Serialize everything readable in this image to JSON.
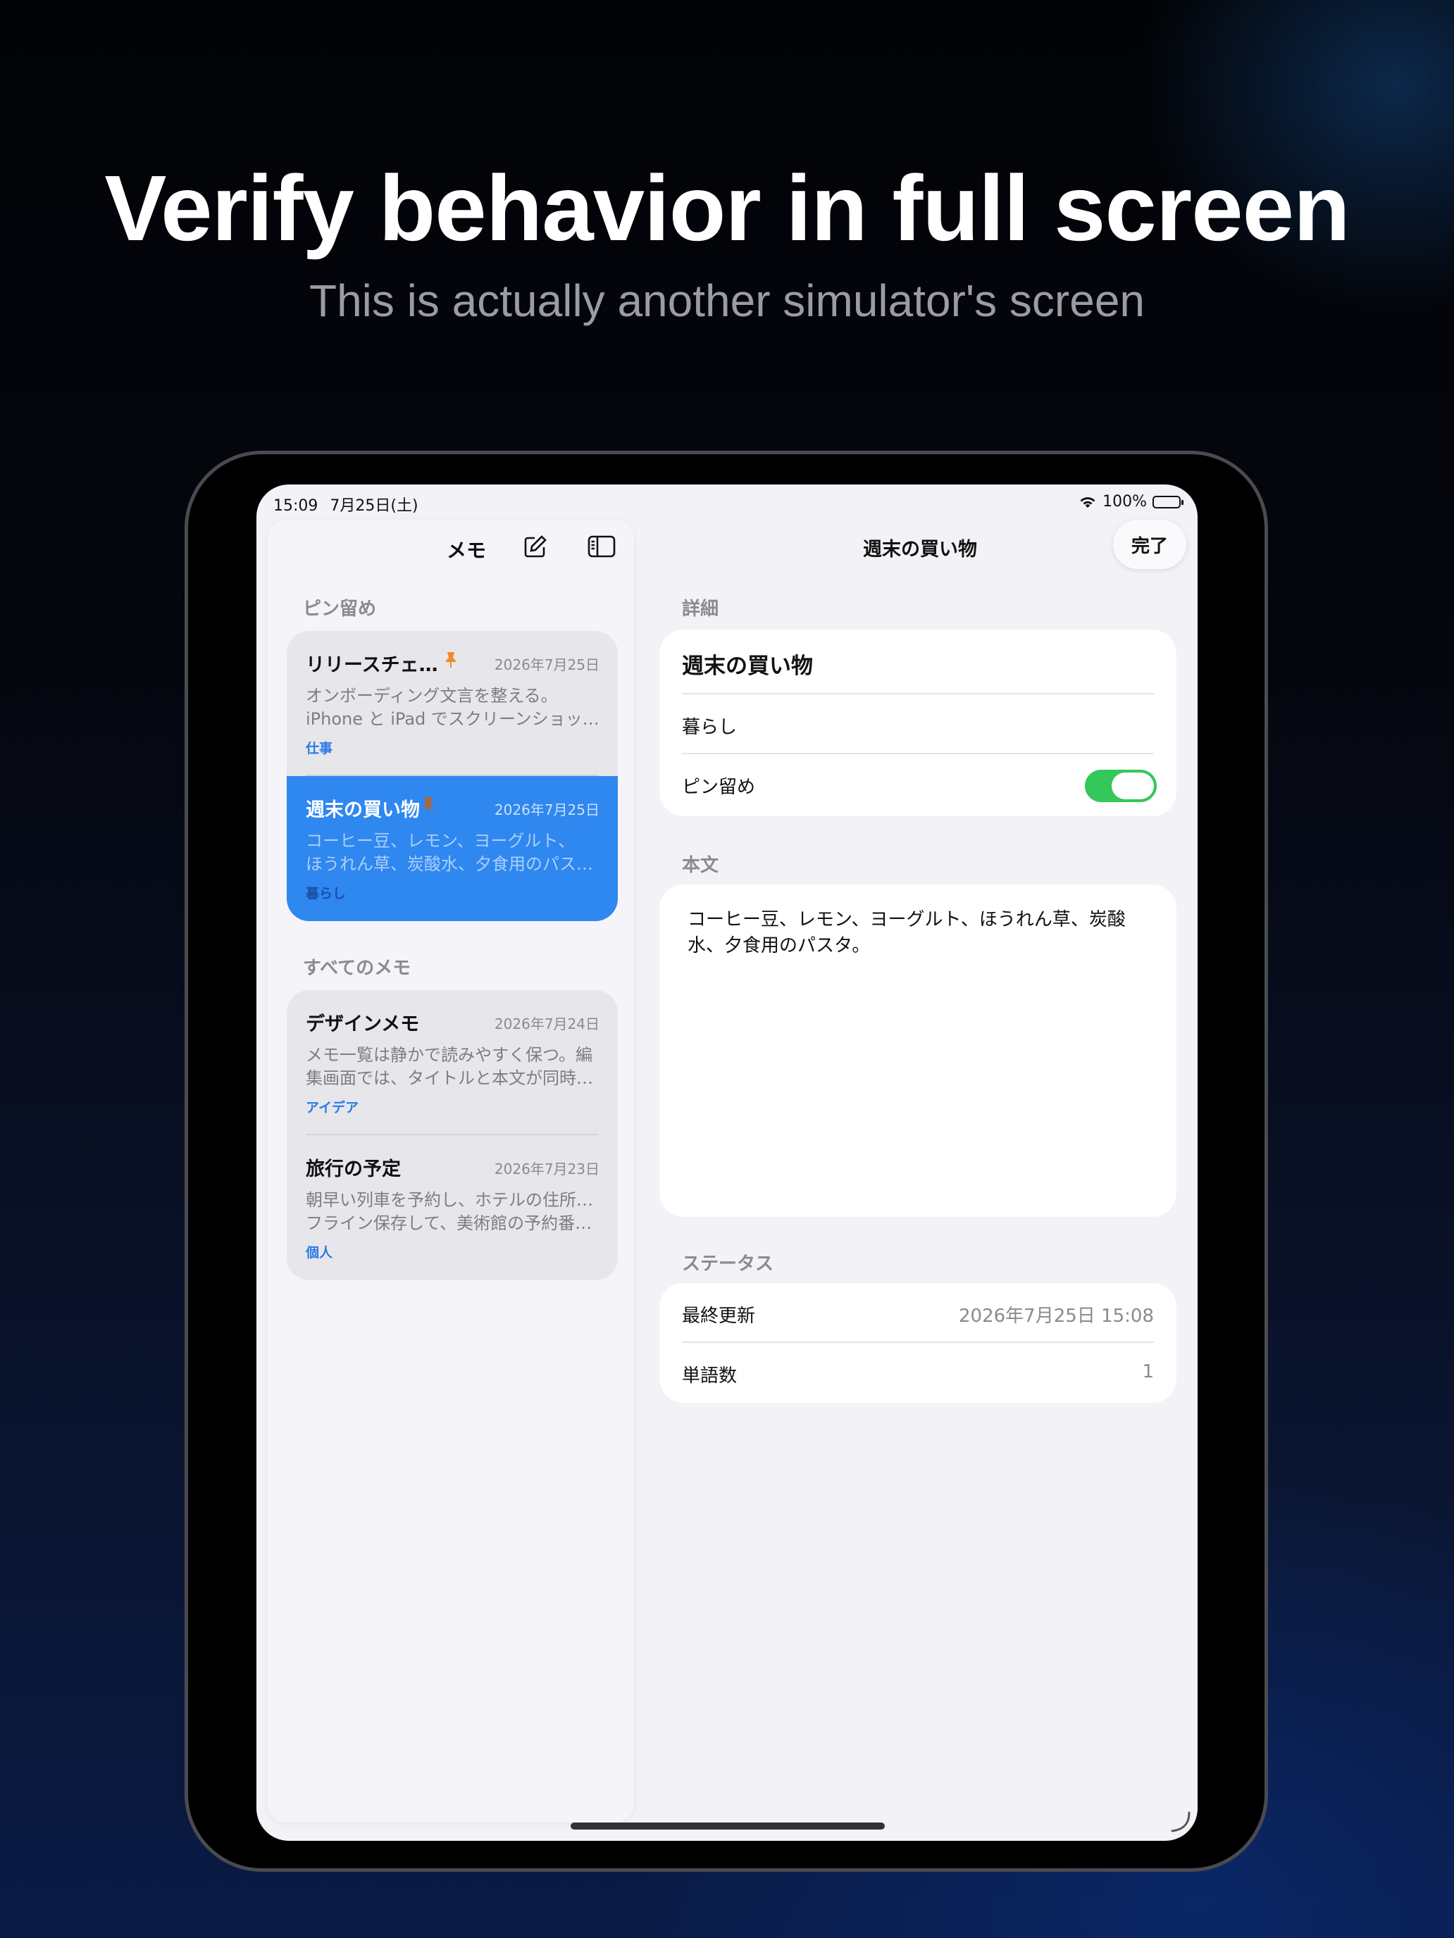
{
  "promo": {
    "headline": "Verify behavior in full screen",
    "subhead": "This is actually another simulator's screen"
  },
  "status_bar": {
    "time": "15:09",
    "date": "7月25日(土)",
    "battery": "100%",
    "battery_level": 1.0
  },
  "sidebar": {
    "title": "メモ",
    "compose_icon": "compose-icon",
    "sidebar_toggle_icon": "sidebar-toggle-icon",
    "pinned_label": "ピン留め",
    "all_label": "すべてのメモ",
    "pinned_notes": [
      {
        "title": "リリースチェ…",
        "date": "2026年7月25日",
        "body_line1": "オンボーディング文言を整える。",
        "body_line2": "iPhone と iPad でスクリーンショッ…",
        "tag": "仕事",
        "selected": false
      },
      {
        "title": "週末の買い物",
        "date": "2026年7月25日",
        "body_line1": "コーヒー豆、レモン、ヨーグルト、",
        "body_line2": "ほうれん草、炭酸水、夕食用のパスタ。",
        "tag": "暮らし",
        "selected": true
      }
    ],
    "all_notes": [
      {
        "title": "デザインメモ",
        "date": "2026年7月24日",
        "body_line1": "メモ一覧は静かで読みやすく保つ。編",
        "body_line2": "集画面では、タイトルと本文が同時に…",
        "tag": "アイデア"
      },
      {
        "title": "旅行の予定",
        "date": "2026年7月23日",
        "body_line1": "朝早い列車を予約し、ホテルの住所をオ",
        "body_line2": "フライン保存して、美術館の予約番号…",
        "tag": "個人"
      }
    ]
  },
  "detail": {
    "nav_title": "週末の買い物",
    "done_label": "完了",
    "details_section": "詳細",
    "note_title": "週末の買い物",
    "category": "暮らし",
    "pin_label": "ピン留め",
    "pinned": true,
    "body_section": "本文",
    "body_line1": "コーヒー豆、レモン、ヨーグルト、ほうれん草、炭酸",
    "body_line2": "水、夕食用のパスタ。",
    "status_section": "ステータス",
    "last_updated_label": "最終更新",
    "last_updated_value": "2026年7月25日 15:08",
    "word_count_label": "単語数",
    "word_count_value": "1"
  },
  "colors": {
    "accent": "#2f87f0",
    "toggle_on": "#34c759",
    "pin": "#f08a2a",
    "tag": "#2a7be4"
  }
}
